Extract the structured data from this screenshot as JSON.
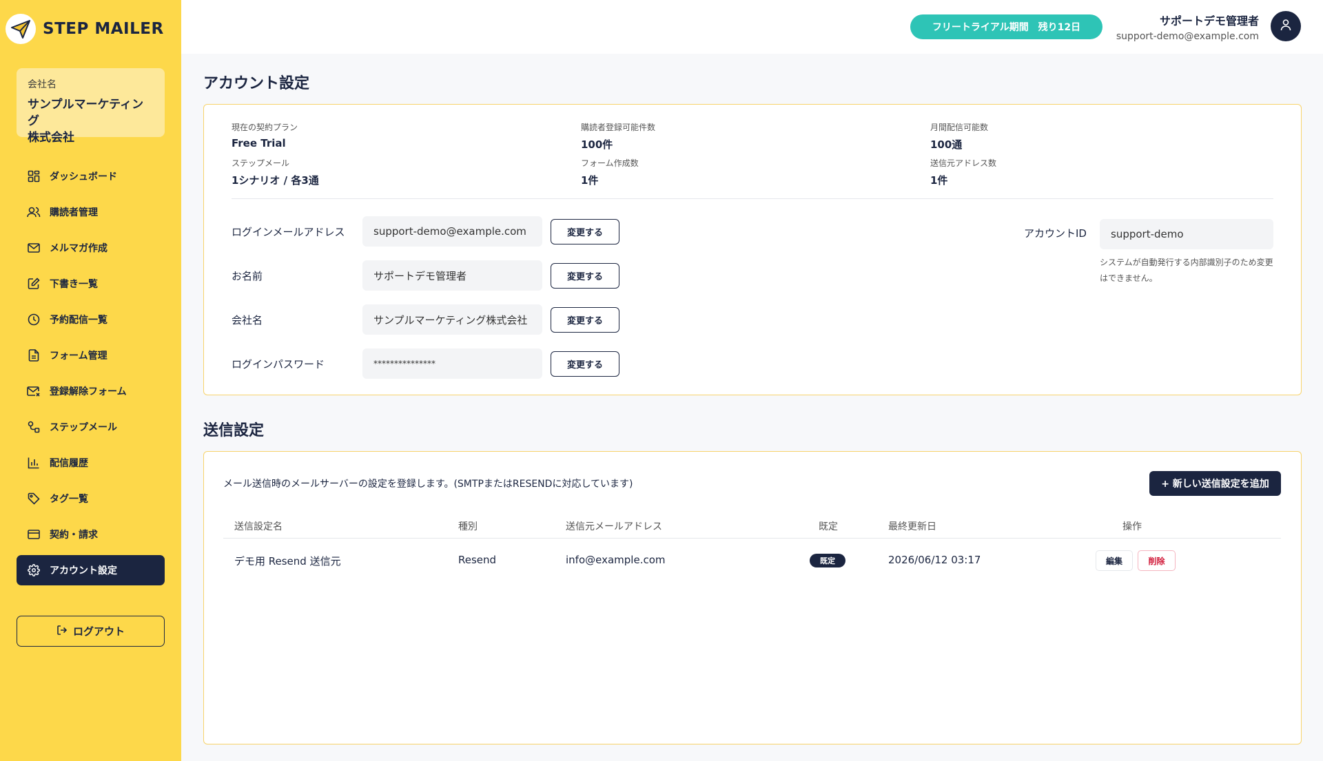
{
  "brand": {
    "name": "STEP MAILER",
    "accent": "#fdd84a",
    "navy": "#1b2540",
    "teal": "#2ec4b6"
  },
  "company": {
    "label": "会社名",
    "name_line1": "サンプルマーケティング",
    "name_line2": "株式会社"
  },
  "sidebar": {
    "items": [
      {
        "label": "ダッシュボード",
        "icon": "dashboard-icon"
      },
      {
        "label": "購読者管理",
        "icon": "users-icon"
      },
      {
        "label": "メルマガ作成",
        "icon": "mail-icon"
      },
      {
        "label": "下書き一覧",
        "icon": "draft-icon"
      },
      {
        "label": "予約配信一覧",
        "icon": "clock-icon"
      },
      {
        "label": "フォーム管理",
        "icon": "document-icon"
      },
      {
        "label": "登録解除フォーム",
        "icon": "mail-x-icon"
      },
      {
        "label": "ステップメール",
        "icon": "steps-icon"
      },
      {
        "label": "配信履歴",
        "icon": "bar-chart-icon"
      },
      {
        "label": "タグ一覧",
        "icon": "tag-icon"
      },
      {
        "label": "契約・請求",
        "icon": "credit-card-icon"
      },
      {
        "label": "アカウント設定",
        "icon": "gear-icon"
      }
    ],
    "active_index": 11,
    "logout_label": "ログアウト"
  },
  "header": {
    "trial_badge": "フリートライアル期間　残り12日",
    "user_name": "サポートデモ管理者",
    "user_email": "support-demo@example.com"
  },
  "account": {
    "title": "アカウント設定",
    "plan": [
      {
        "label": "現在の契約プラン",
        "value": "Free Trial"
      },
      {
        "label": "購読者登録可能件数",
        "value": "100件"
      },
      {
        "label": "月間配信可能数",
        "value": "100通"
      },
      {
        "label": "ステップメール",
        "value": "1シナリオ / 各3通"
      },
      {
        "label": "フォーム作成数",
        "value": "1件"
      },
      {
        "label": "送信元アドレス数",
        "value": "1件"
      }
    ],
    "fields": [
      {
        "label": "ログインメールアドレス",
        "value": "support-demo@example.com"
      },
      {
        "label": "お名前",
        "value": "サポートデモ管理者"
      },
      {
        "label": "会社名",
        "value": "サンプルマーケティング株式会社"
      },
      {
        "label": "ログインパスワード",
        "value": "***************"
      }
    ],
    "change_label": "変更する",
    "account_id_label": "アカウントID",
    "account_id_value": "support-demo",
    "account_id_note": "システムが自動発行する内部識別子のため変更はできません。"
  },
  "sending": {
    "title": "送信設定",
    "description": "メール送信時のメールサーバーの設定を登録します。(SMTPまたはRESENDに対応しています)",
    "add_button": "+ 新しい送信設定を追加",
    "columns": [
      "送信設定名",
      "種別",
      "送信元メールアドレス",
      "既定",
      "最終更新日",
      "操作"
    ],
    "rows": [
      {
        "name": "デモ用 Resend 送信元",
        "type": "Resend",
        "from": "info@example.com",
        "default": "既定",
        "updated": "2026/06/12 03:17",
        "edit": "編集",
        "delete": "削除"
      }
    ]
  }
}
